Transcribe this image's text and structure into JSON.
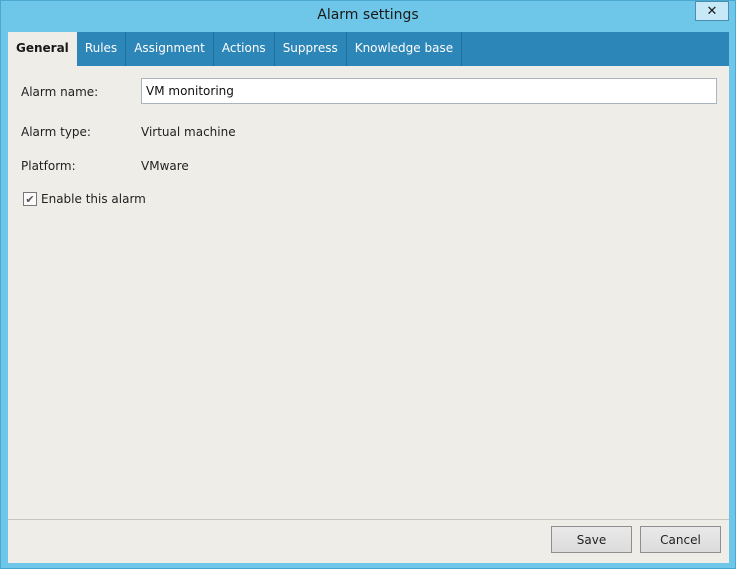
{
  "window": {
    "title": "Alarm settings",
    "close_glyph": "✕"
  },
  "tabs": [
    {
      "label": "General",
      "active": true
    },
    {
      "label": "Rules",
      "active": false
    },
    {
      "label": "Assignment",
      "active": false
    },
    {
      "label": "Actions",
      "active": false
    },
    {
      "label": "Suppress",
      "active": false
    },
    {
      "label": "Knowledge base",
      "active": false
    }
  ],
  "form": {
    "alarm_name_label": "Alarm name:",
    "alarm_name_value": "VM monitoring",
    "alarm_type_label": "Alarm type:",
    "alarm_type_value": "Virtual machine",
    "platform_label": "Platform:",
    "platform_value": "VMware",
    "enable_label": "Enable this alarm",
    "enable_checked": true,
    "check_glyph": "✔"
  },
  "buttons": {
    "save": "Save",
    "cancel": "Cancel"
  },
  "colors": {
    "titlebar": "#6ec6e8",
    "tabbar": "#2d86b8",
    "client_bg": "#efede8"
  }
}
